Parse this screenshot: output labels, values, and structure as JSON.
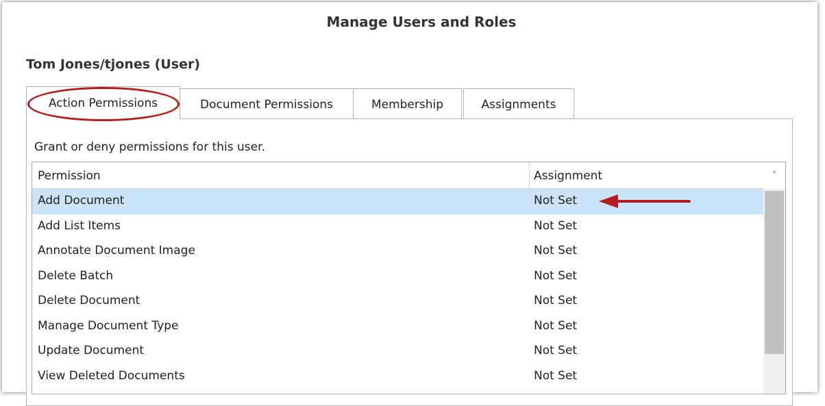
{
  "window": {
    "title": "Manage Users and Roles"
  },
  "user": {
    "heading": "Tom Jones/tjones (User)"
  },
  "tabs": [
    {
      "label": "Action Permissions",
      "active": true
    },
    {
      "label": "Document Permissions",
      "active": false
    },
    {
      "label": "Membership",
      "active": false
    },
    {
      "label": "Assignments",
      "active": false
    }
  ],
  "panel": {
    "description": "Grant or deny permissions for this user."
  },
  "grid": {
    "columns": [
      "Permission",
      "Assignment"
    ],
    "rows": [
      {
        "permission": "Add Document",
        "assignment": "Not Set",
        "selected": true
      },
      {
        "permission": "Add List Items",
        "assignment": "Not Set"
      },
      {
        "permission": "Annotate Document Image",
        "assignment": "Not Set"
      },
      {
        "permission": "Delete Batch",
        "assignment": "Not Set"
      },
      {
        "permission": "Delete Document",
        "assignment": "Not Set"
      },
      {
        "permission": "Manage Document Type",
        "assignment": "Not Set"
      },
      {
        "permission": "Update Document",
        "assignment": "Not Set"
      },
      {
        "permission": "View Deleted Documents",
        "assignment": "Not Set"
      }
    ]
  },
  "colors": {
    "selected_row": "#cce4f7",
    "annotation": "#b01e22"
  },
  "icons": {
    "scroll_up": "chevron-up-icon",
    "annotation_arrow": "arrow-left-icon"
  }
}
